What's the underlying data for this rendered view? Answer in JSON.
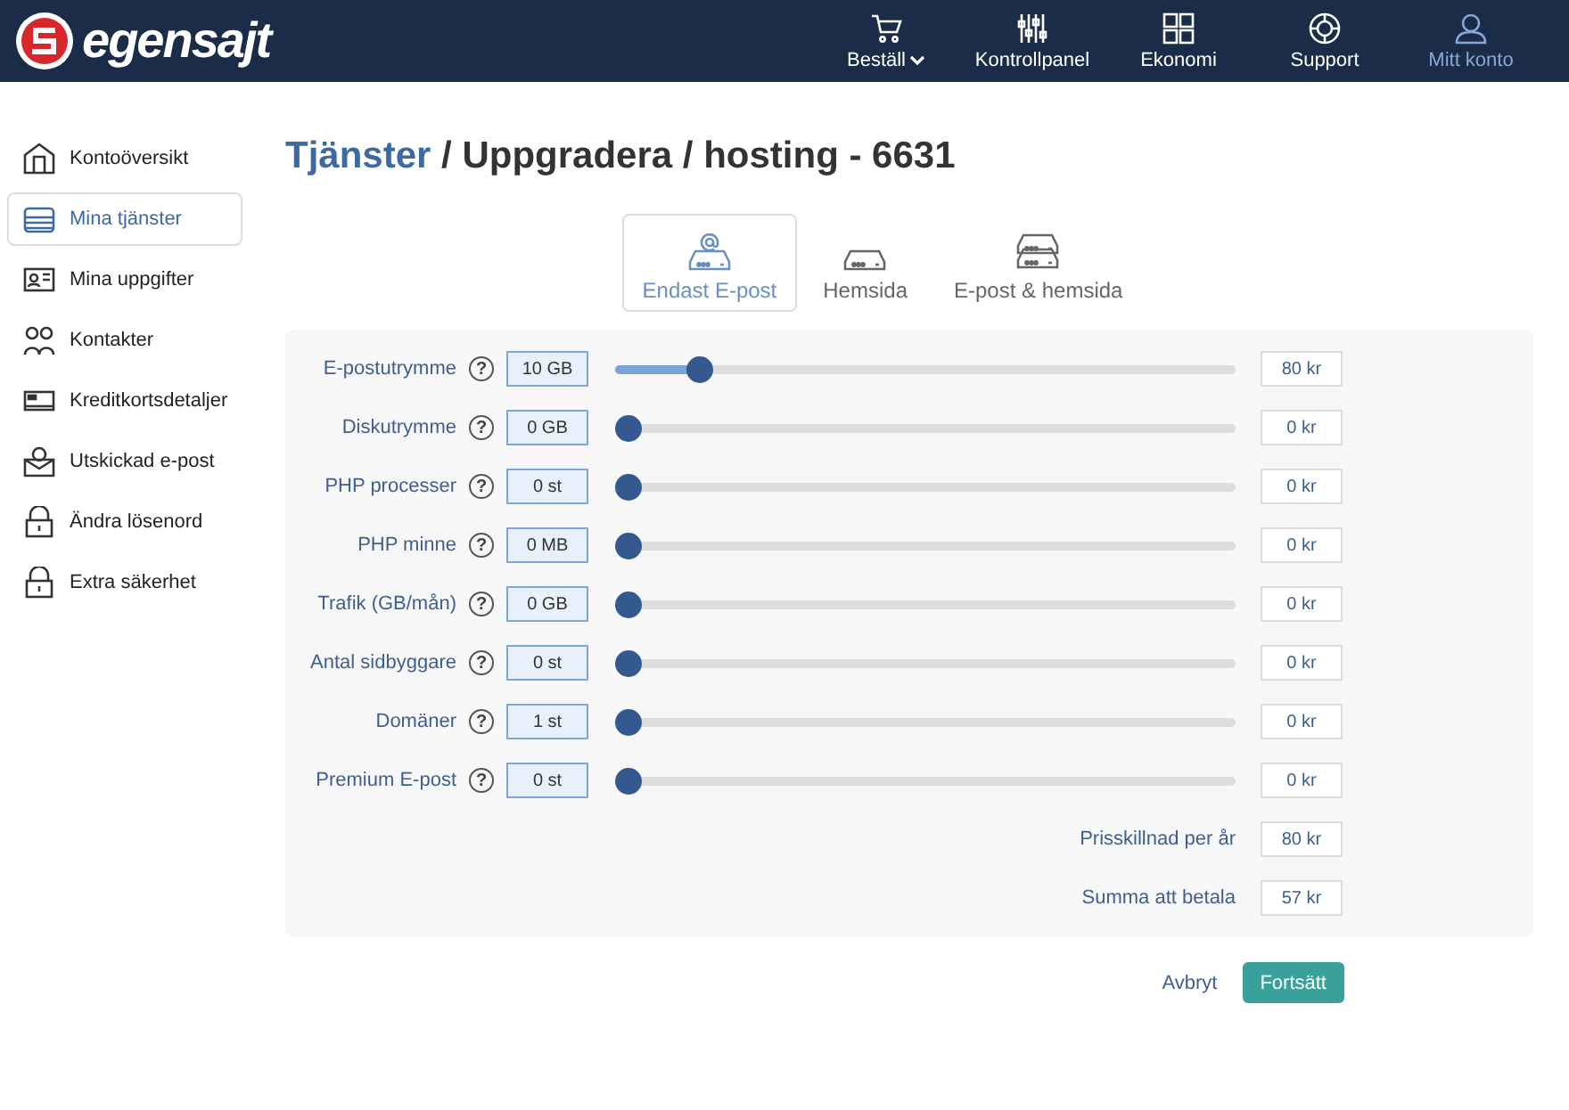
{
  "logo": {
    "text": "egensajt"
  },
  "nav": [
    {
      "label": "Beställ",
      "kind": "cart",
      "dropdown": true,
      "selected": false
    },
    {
      "label": "Kontrollpanel",
      "kind": "sliders",
      "dropdown": false,
      "selected": false
    },
    {
      "label": "Ekonomi",
      "kind": "grid",
      "dropdown": false,
      "selected": false
    },
    {
      "label": "Support",
      "kind": "lifebuoy",
      "dropdown": false,
      "selected": false
    },
    {
      "label": "Mitt konto",
      "kind": "user",
      "dropdown": false,
      "selected": true
    }
  ],
  "sidebar": {
    "items": [
      {
        "label": "Kontoöversikt",
        "kind": "house",
        "selected": false
      },
      {
        "label": "Mina tjänster",
        "kind": "server",
        "selected": true
      },
      {
        "label": "Mina uppgifter",
        "kind": "idcard",
        "selected": false
      },
      {
        "label": "Kontakter",
        "kind": "people",
        "selected": false
      },
      {
        "label": "Kreditkortsdetaljer",
        "kind": "card",
        "selected": false
      },
      {
        "label": "Utskickad e-post",
        "kind": "mail",
        "selected": false
      },
      {
        "label": "Ändra lösenord",
        "kind": "lock",
        "selected": false
      },
      {
        "label": "Extra säkerhet",
        "kind": "lock",
        "selected": false
      }
    ]
  },
  "breadcrumb": {
    "link": "Tjänster",
    "rest": "/ Uppgradera / hosting - 6631"
  },
  "tabs": [
    {
      "label": "Endast E-post",
      "kind": "mail",
      "selected": true
    },
    {
      "label": "Hemsida",
      "kind": "single",
      "selected": false
    },
    {
      "label": "E-post & hemsida",
      "kind": "double",
      "selected": false
    }
  ],
  "rows": [
    {
      "label": "E-postutrymme",
      "help": "?",
      "value": "10 GB",
      "level": 0.12,
      "price": "80 kr"
    },
    {
      "label": "Diskutrymme",
      "help": "?",
      "value": "0 GB",
      "level": 0,
      "price": "0 kr"
    },
    {
      "label": "PHP processer",
      "help": "?",
      "value": "0 st",
      "level": 0,
      "price": "0 kr"
    },
    {
      "label": "PHP minne",
      "help": "?",
      "value": "0 MB",
      "level": 0,
      "price": "0 kr"
    },
    {
      "label": "Trafik (GB/mån)",
      "help": "?",
      "value": "0 GB",
      "level": 0,
      "price": "0 kr"
    },
    {
      "label": "Antal sidbyggare",
      "help": "?",
      "value": "0 st",
      "level": 0,
      "price": "0 kr"
    },
    {
      "label": "Domäner",
      "help": "?",
      "value": "1 st",
      "level": 0,
      "price": "0 kr"
    },
    {
      "label": "Premium E-post",
      "help": "?",
      "value": "0 st",
      "level": 0,
      "price": "0 kr"
    }
  ],
  "totals": [
    {
      "label": "Prisskillnad per år",
      "value": "80 kr"
    },
    {
      "label": "Summa att betala",
      "value": "57 kr"
    }
  ],
  "buttons": {
    "cancel": "Avbryt",
    "continue": "Fortsätt"
  }
}
